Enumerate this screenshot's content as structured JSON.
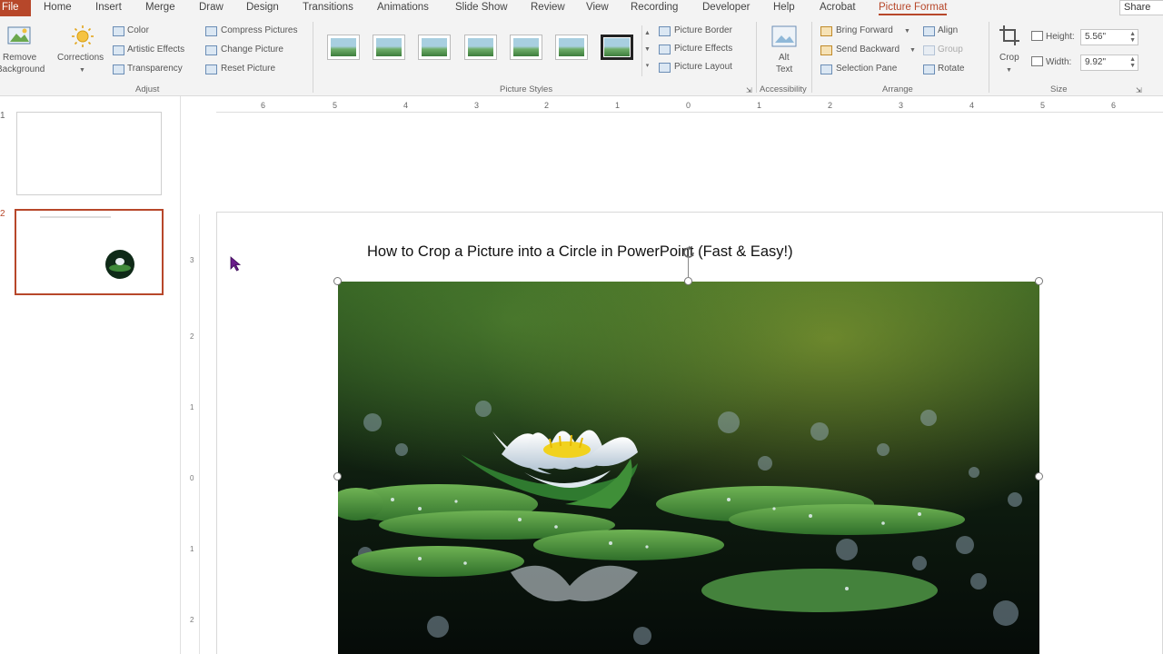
{
  "tabs": [
    "File",
    "Home",
    "Insert",
    "Merge",
    "Draw",
    "Design",
    "Transitions",
    "Animations",
    "Slide Show",
    "Review",
    "View",
    "Recording",
    "Developer",
    "Help",
    "Acrobat",
    "Picture Format"
  ],
  "share_label": "Share",
  "ribbon": {
    "remove_bg": [
      "Remove",
      "Background"
    ],
    "corrections": "Corrections",
    "color": "Color",
    "artistic_effects": "Artistic Effects",
    "transparency": "Transparency",
    "compress": "Compress Pictures",
    "change": "Change Picture",
    "reset": "Reset Picture",
    "adjust_label": "Adjust",
    "picture_styles_label": "Picture Styles",
    "picture_border": "Picture Border",
    "picture_effects": "Picture Effects",
    "picture_layout": "Picture Layout",
    "alt_text": [
      "Alt",
      "Text"
    ],
    "accessibility_label": "Accessibility",
    "bring_forward": "Bring Forward",
    "send_backward": "Send Backward",
    "selection_pane": "Selection Pane",
    "align": "Align",
    "group": "Group",
    "rotate": "Rotate",
    "arrange_label": "Arrange",
    "crop": "Crop",
    "height_label": "Height:",
    "height_value": "5.56\"",
    "width_label": "Width:",
    "width_value": "9.92\"",
    "size_label": "Size"
  },
  "slide_numbers": [
    "1",
    "2"
  ],
  "slide_title": "How to Crop a Picture into a Circle in PowerPoint (Fast & Easy!)",
  "ruler_h": [
    "6",
    "5",
    "4",
    "3",
    "2",
    "1",
    "0",
    "1",
    "2",
    "3",
    "4",
    "5",
    "6"
  ],
  "ruler_v": [
    "3",
    "2",
    "1",
    "0",
    "1",
    "2"
  ],
  "colors": {
    "accent": "#b7472a",
    "ribbon_bg": "#f3f3f3"
  }
}
